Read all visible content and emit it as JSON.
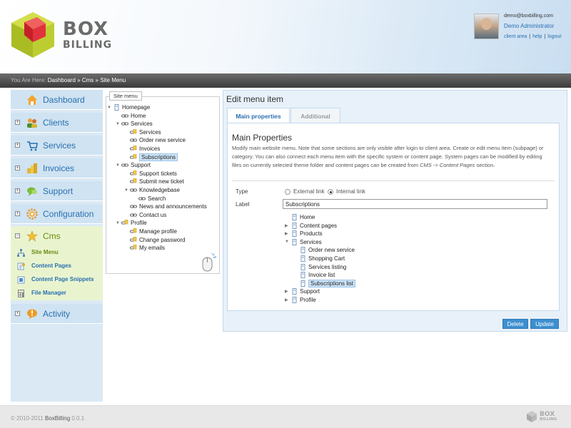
{
  "logo": {
    "line1": "BOX",
    "line2": "BILLING"
  },
  "user": {
    "email": "demo@boxbilling.com",
    "name": "Demo Administrator",
    "links": [
      "client area",
      "help",
      "logout"
    ]
  },
  "breadcrumb": {
    "prefix": "You Are Here:",
    "items": [
      "Dashboard",
      "Cms",
      "Site Menu"
    ],
    "separator": "»"
  },
  "sidebar": {
    "items": [
      {
        "label": "Dashboard",
        "icon": "house-icon"
      },
      {
        "label": "Clients",
        "icon": "users-icon"
      },
      {
        "label": "Services",
        "icon": "cart-icon"
      },
      {
        "label": "Invoices",
        "icon": "coins-icon"
      },
      {
        "label": "Support",
        "icon": "chat-icon"
      },
      {
        "label": "Configuration",
        "icon": "gear-icon"
      },
      {
        "label": "Cms",
        "icon": "star-icon"
      },
      {
        "label": "Activity",
        "icon": "alert-icon"
      }
    ],
    "cms_subitems": [
      {
        "label": "Site Menu",
        "icon": "sitemap-icon",
        "active": true
      },
      {
        "label": "Content Pages",
        "icon": "pages-icon"
      },
      {
        "label": "Content Page Snippets",
        "icon": "snippet-icon"
      },
      {
        "label": "File Manager",
        "icon": "calculator-icon"
      }
    ],
    "expand_symbol": "+",
    "collapse_symbol": "−"
  },
  "site_menu": {
    "legend": "Site menu",
    "tree": [
      {
        "label": "Homepage",
        "level": 0,
        "toggle": "▼",
        "icon": "page"
      },
      {
        "label": "Home",
        "level": 1,
        "icon": "link"
      },
      {
        "label": "Services",
        "level": 1,
        "toggle": "▼",
        "icon": "link"
      },
      {
        "label": "Services",
        "level": 2,
        "icon": "page-link"
      },
      {
        "label": "Order new service",
        "level": 2,
        "icon": "link"
      },
      {
        "label": "Invoices",
        "level": 2,
        "icon": "page-link"
      },
      {
        "label": "Subscriptions",
        "level": 2,
        "icon": "page-link",
        "selected": true
      },
      {
        "label": "Support",
        "level": 1,
        "toggle": "▼",
        "icon": "link"
      },
      {
        "label": "Support tickets",
        "level": 2,
        "icon": "page-link"
      },
      {
        "label": "Submit new ticket",
        "level": 2,
        "icon": "page-link"
      },
      {
        "label": "Knowledgebase",
        "level": 2,
        "toggle": "▼",
        "icon": "link"
      },
      {
        "label": "Search",
        "level": 3,
        "icon": "link"
      },
      {
        "label": "News and announcements",
        "level": 2,
        "icon": "link"
      },
      {
        "label": "Contact us",
        "level": 2,
        "icon": "link"
      },
      {
        "label": "Profile",
        "level": 1,
        "toggle": "▼",
        "icon": "page-link"
      },
      {
        "label": "Manage profile",
        "level": 2,
        "icon": "page-link"
      },
      {
        "label": "Change password",
        "level": 2,
        "icon": "page-link"
      },
      {
        "label": "My emails",
        "level": 2,
        "icon": "page-link"
      }
    ]
  },
  "edit": {
    "title": "Edit menu item",
    "tabs": [
      "Main properties",
      "Additional"
    ],
    "section_title": "Main Properties",
    "description_parts": [
      "Modify main website menu. Note that some sections are only visible after login to client area. Create or edit menu item (subpage) or category. You can also connect each menu item with the specific system or content page. System pages can be modified by editing files on currently selected theme folder and content pages can be created from ",
      "CMS -> Content Pages",
      " section."
    ],
    "type_label": "Type",
    "type_options": [
      {
        "label": "External link",
        "checked": false
      },
      {
        "label": "Internal link",
        "checked": true
      }
    ],
    "label_label": "Label",
    "label_value": "Subscriptions",
    "page_tree": [
      {
        "label": "Home",
        "level": 0
      },
      {
        "label": "Content pages",
        "level": 0,
        "toggle": "▶"
      },
      {
        "label": "Products",
        "level": 0,
        "toggle": "▶"
      },
      {
        "label": "Services",
        "level": 0,
        "toggle": "▼"
      },
      {
        "label": "Order new service",
        "level": 1
      },
      {
        "label": "Shopping Cart",
        "level": 1
      },
      {
        "label": "Services listing",
        "level": 1
      },
      {
        "label": "Invoice list",
        "level": 1
      },
      {
        "label": "Subscriptions list",
        "level": 1,
        "selected": true
      },
      {
        "label": "Support",
        "level": 0,
        "toggle": "▶"
      },
      {
        "label": "Profile",
        "level": 0,
        "toggle": "▶"
      }
    ],
    "delete_label": "Delete",
    "update_label": "Update"
  },
  "footer": {
    "copyright": "© 2010-2011",
    "product": "BoxBilling",
    "version": "0.0.1",
    "logo_line1": "BOX",
    "logo_line2": "BILLING"
  },
  "colors": {
    "accent": "#2a6fb0",
    "cms_green": "#6b8a12",
    "button": "#3d8fd0",
    "sidebar_bg": "#cfe3f2",
    "cms_bg": "#e9f4cf"
  }
}
